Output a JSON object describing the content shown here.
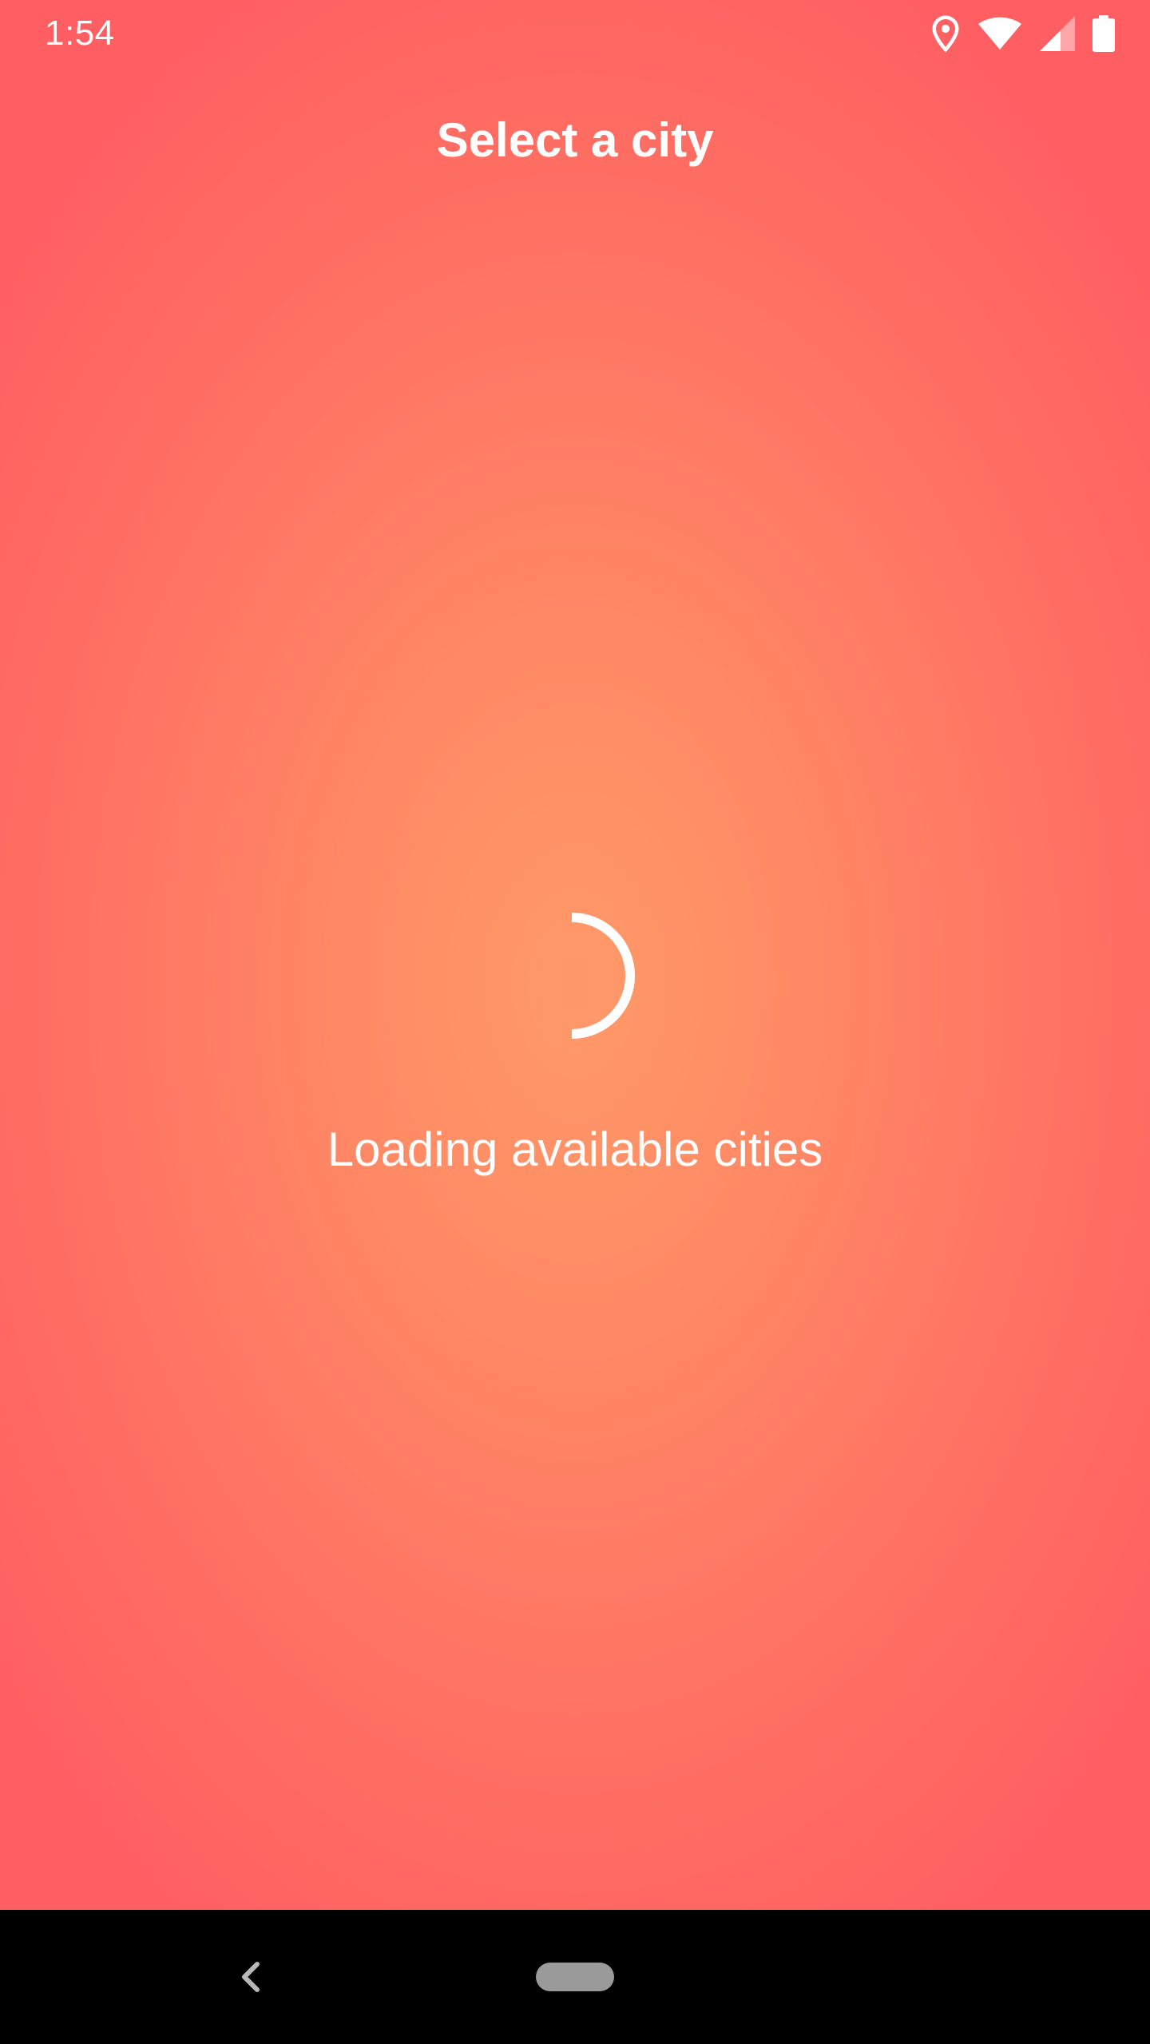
{
  "status_bar": {
    "time": "1:54",
    "icons": [
      "location-icon",
      "wifi-icon",
      "cell-signal-icon",
      "battery-icon"
    ]
  },
  "header": {
    "title": "Select a city"
  },
  "main": {
    "loading_text": "Loading available cities",
    "spinner": "loading-spinner-icon"
  },
  "navigation_bar": {
    "back": "back-icon",
    "home": "home-pill"
  },
  "colors": {
    "background_center": "#ff9a68",
    "background_edge": "#ff5f62",
    "text": "#ffffff",
    "nav_bar": "#000000"
  }
}
